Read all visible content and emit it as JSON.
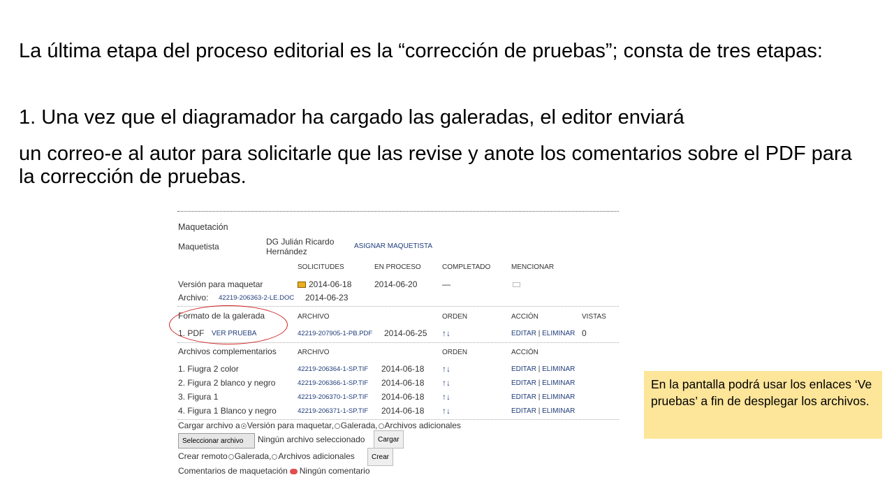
{
  "slide": {
    "paragraph1": "La última etapa del proceso editorial es la “corrección de pruebas”; consta de tres etapas:",
    "paragraph2": "1. Una vez que el diagramador ha cargado las galeradas, el editor enviará",
    "paragraph3": "un correo-e al autor para solicitarle que las revise y anote los comentarios sobre el PDF para la corrección de pruebas.",
    "note": "En la pantalla podrá usar los enlaces ‘Ve pruebas’ a fin de desplegar los  archivos."
  },
  "screenshot": {
    "section_title": "Maquetación",
    "maquetista_label": "Maquetista",
    "maquetista_name_line1": "DG Julián Ricardo",
    "maquetista_name_line2": "Hernández",
    "assign_link": "ASIGNAR MAQUETISTA",
    "columns": {
      "solicitudes": "SOLICITUDES",
      "en_proceso": "EN PROCESO",
      "completado": "COMPLETADO",
      "mencionar": "MENCIONAR"
    },
    "version": {
      "label": "Versión para maquetar",
      "solicitudes": "2014-06-18",
      "en_proceso": "2014-06-20",
      "completado": "—"
    },
    "archivo": {
      "label": "Archivo:",
      "file": "42219-206363-2-LE.DOC",
      "date": "2014-06-23"
    },
    "galerada": {
      "label": "Formato de la galerada",
      "col_archivo": "ARCHIVO",
      "col_orden": "ORDEN",
      "col_accion": "ACCIÓN",
      "col_vistas": "VISTAS",
      "row_label": "1. PDF",
      "view_link": "VER PRUEBA",
      "file": "42219-207905-1-PB.PDF",
      "date": "2014-06-25",
      "order": "↑↓",
      "edit": "EDITAR",
      "delete": "ELIMINAR",
      "separator": "|",
      "views": "0"
    },
    "complementarios": {
      "label": "Archivos complementarios",
      "col_archivo": "ARCHIVO",
      "col_orden": "ORDEN",
      "col_accion": "ACCIÓN",
      "rows": [
        {
          "name": "1. Fiugra 2 color",
          "file": "42219-206364-1-SP.TIF",
          "date": "2014-06-18",
          "order": "↑↓",
          "edit": "EDITAR",
          "sep": "|",
          "delete": "ELIMINAR"
        },
        {
          "name": "2. Figura 2 blanco y negro",
          "file": "42219-206366-1-SP.TIF",
          "date": "2014-06-18",
          "order": "↑↓",
          "edit": "EDITAR",
          "sep": "|",
          "delete": "ELIMINAR"
        },
        {
          "name": "3. Figura 1",
          "file": "42219-206370-1-SP.TIF",
          "date": "2014-06-18",
          "order": "↑↓",
          "edit": "EDITAR",
          "sep": "|",
          "delete": "ELIMINAR"
        },
        {
          "name": "4. Figura 1 Blanco y negro",
          "file": "42219-206371-1-SP.TIF",
          "date": "2014-06-18",
          "order": "↑↓",
          "edit": "EDITAR",
          "sep": "|",
          "delete": "ELIMINAR"
        }
      ]
    },
    "upload": {
      "label": "Cargar archivo a",
      "opt1": "Versión para maquetar,",
      "opt2": "Galerada,",
      "opt3": "Archivos adicionales",
      "select_button": "Seleccionar archivo",
      "no_file": "Ningún archivo seleccionado",
      "upload_button": "Cargar"
    },
    "remote": {
      "label": "Crear remoto",
      "opt1": "Galerada,",
      "opt2": "Archivos adicionales",
      "create_button": "Crear"
    },
    "comments": {
      "label": "Comentarios de maquetación",
      "value": "Ningún comentario"
    }
  }
}
